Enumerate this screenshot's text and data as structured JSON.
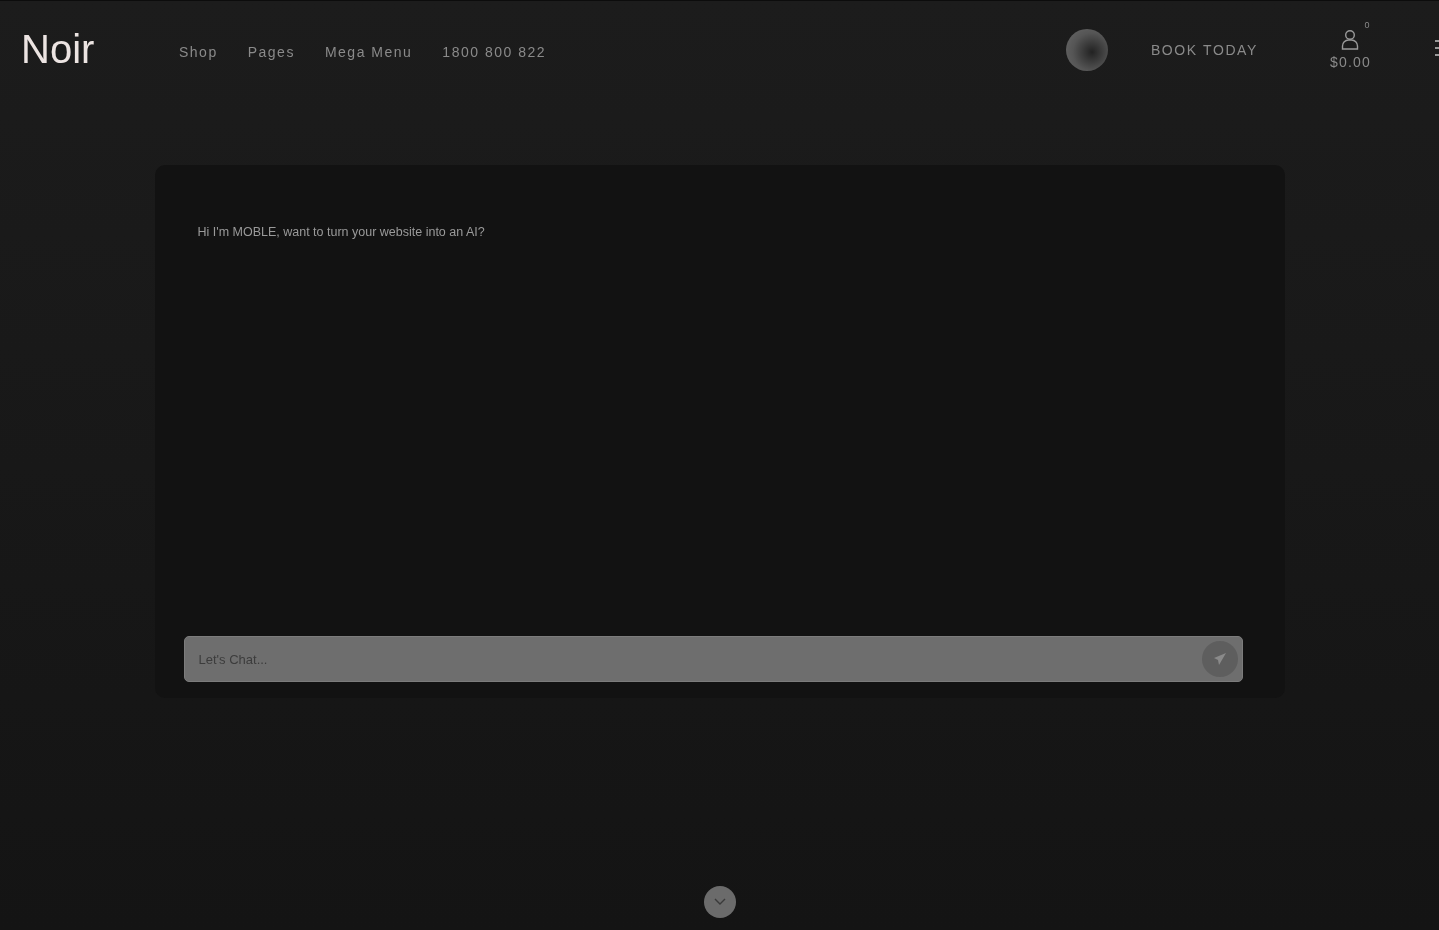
{
  "header": {
    "logo": "Noir",
    "nav": [
      {
        "label": "Shop"
      },
      {
        "label": "Pages"
      },
      {
        "label": "Mega Menu"
      },
      {
        "label": "1800 800 822"
      }
    ],
    "book_button": "BOOK TODAY",
    "cart": {
      "count": "0",
      "total": "$0.00"
    }
  },
  "chat": {
    "message": "Hi I'm MOBLE, want to turn your website into an AI?",
    "input": {
      "placeholder": "Let's Chat..."
    }
  }
}
